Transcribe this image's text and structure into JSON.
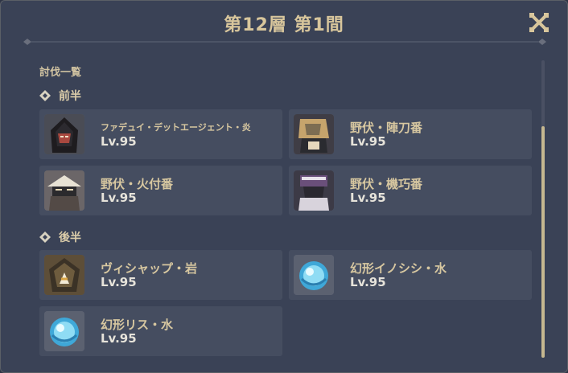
{
  "title": "第12層 第1間",
  "section_label": "討伐一覧",
  "first_half": {
    "label": "前半",
    "enemies": [
      {
        "name": "ファデュイ・デットエージェント・炎",
        "level": "Lv.95",
        "icon": "fatui-agent-icon"
      },
      {
        "name": "野伏・陣刀番",
        "level": "Lv.95",
        "icon": "nobushi-jintouban-icon"
      },
      {
        "name": "野伏・火付番",
        "level": "Lv.95",
        "icon": "nobushi-hitsukeban-icon"
      },
      {
        "name": "野伏・機巧番",
        "level": "Lv.95",
        "icon": "nobushi-kikouban-icon"
      }
    ]
  },
  "second_half": {
    "label": "後半",
    "enemies": [
      {
        "name": "ヴィシャップ・岩",
        "level": "Lv.95",
        "icon": "geovishap-icon"
      },
      {
        "name": "幻形イノシシ・水",
        "level": "Lv.95",
        "icon": "hydro-mimic-boar-icon"
      },
      {
        "name": "幻形リス・水",
        "level": "Lv.95",
        "icon": "hydro-mimic-squirrel-icon"
      }
    ]
  },
  "colors": {
    "background": "#3a4256",
    "card": "#454d60",
    "title": "#d8c69c",
    "accent": "#c6b890"
  }
}
